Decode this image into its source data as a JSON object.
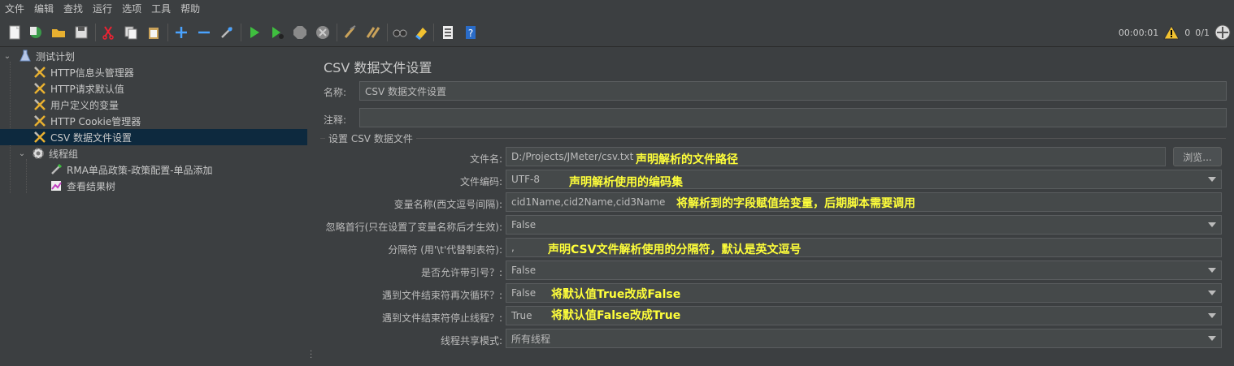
{
  "menu": [
    "文件",
    "编辑",
    "查找",
    "运行",
    "选项",
    "工具",
    "帮助"
  ],
  "status": {
    "time": "00:00:01",
    "warnings": "0",
    "threads": "0/1"
  },
  "tree": [
    {
      "label": "测试计划",
      "icon": "flask-icon"
    },
    {
      "label": "HTTP信息头管理器",
      "icon": "wrench-screwdriver-icon"
    },
    {
      "label": "HTTP请求默认值",
      "icon": "wrench-screwdriver-icon"
    },
    {
      "label": "用户定义的变量",
      "icon": "wrench-screwdriver-icon"
    },
    {
      "label": "HTTP Cookie管理器",
      "icon": "wrench-screwdriver-icon"
    },
    {
      "label": "CSV 数据文件设置",
      "icon": "wrench-screwdriver-icon"
    },
    {
      "label": "线程组",
      "icon": "gear-icon"
    },
    {
      "label": "RMA单品政策-政策配置-单品添加",
      "icon": "pipette-icon"
    },
    {
      "label": "查看结果树",
      "icon": "chart-icon"
    }
  ],
  "panel": {
    "title": "CSV 数据文件设置",
    "name_label": "名称:",
    "name_value": "CSV 数据文件设置",
    "comment_label": "注释:",
    "comment_value": "",
    "group_title": "设置 CSV 数据文件",
    "browse_label": "浏览...",
    "rows": [
      {
        "label": "文件名:",
        "value": "D:/Projects/JMeter/csv.txt",
        "annotation": "声明解析的文件路径"
      },
      {
        "label": "文件编码:",
        "value": "UTF-8",
        "annotation": "声明解析使用的编码集"
      },
      {
        "label": "变量名称(西文逗号间隔):",
        "value": "cid1Name,cid2Name,cid3Name",
        "annotation": "将解析到的字段赋值给变量，后期脚本需要调用"
      },
      {
        "label": "忽略首行(只在设置了变量名称后才生效):",
        "value": "False",
        "annotation": ""
      },
      {
        "label": "分隔符 (用'\\t'代替制表符):",
        "value": ",",
        "annotation": "声明CSV文件解析使用的分隔符，默认是英文逗号"
      },
      {
        "label": "是否允许带引号？:",
        "value": "False",
        "annotation": ""
      },
      {
        "label": "遇到文件结束符再次循环？:",
        "value": "False",
        "annotation": "将默认值True改成False"
      },
      {
        "label": "遇到文件结束符停止线程？:",
        "value": "True",
        "annotation": "将默认值False改成True"
      },
      {
        "label": "线程共享模式:",
        "value": "所有线程",
        "annotation": ""
      }
    ]
  },
  "colors": {
    "annotation": "#ffff3a",
    "selection": "#0d293e",
    "background": "#3c3f41"
  }
}
